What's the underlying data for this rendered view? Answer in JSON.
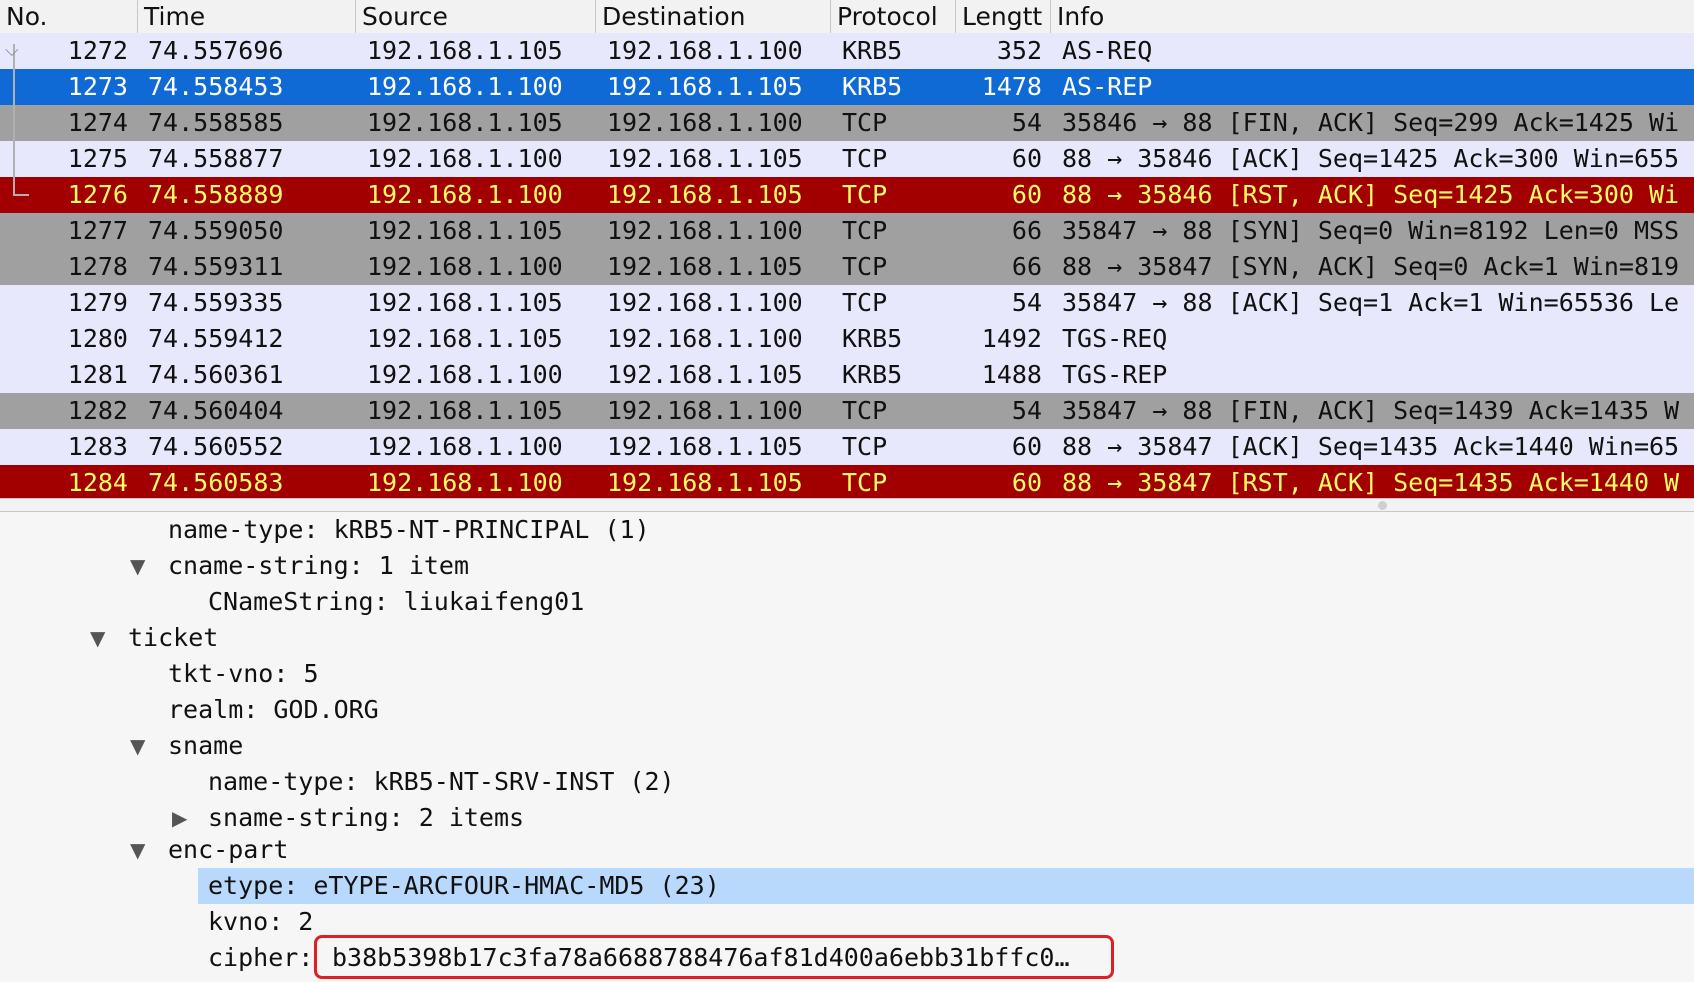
{
  "columns": {
    "no": "No.",
    "time": "Time",
    "source": "Source",
    "destination": "Destination",
    "protocol": "Protocol",
    "length": "Lengtt",
    "info": "Info"
  },
  "packets": [
    {
      "no": "1272",
      "time": "74.557696",
      "src": "192.168.1.105",
      "dst": "192.168.1.100",
      "proto": "KRB5",
      "len": "352",
      "info": "AS-REQ",
      "style": "lav"
    },
    {
      "no": "1273",
      "time": "74.558453",
      "src": "192.168.1.100",
      "dst": "192.168.1.105",
      "proto": "KRB5",
      "len": "1478",
      "info": "AS-REP",
      "style": "sel"
    },
    {
      "no": "1274",
      "time": "74.558585",
      "src": "192.168.1.105",
      "dst": "192.168.1.100",
      "proto": "TCP",
      "len": "54",
      "info": "35846 → 88 [FIN, ACK] Seq=299 Ack=1425 Wi",
      "style": "gray"
    },
    {
      "no": "1275",
      "time": "74.558877",
      "src": "192.168.1.100",
      "dst": "192.168.1.105",
      "proto": "TCP",
      "len": "60",
      "info": "88 → 35846 [ACK] Seq=1425 Ack=300 Win=655",
      "style": "lav"
    },
    {
      "no": "1276",
      "time": "74.558889",
      "src": "192.168.1.100",
      "dst": "192.168.1.105",
      "proto": "TCP",
      "len": "60",
      "info": "88 → 35846 [RST, ACK] Seq=1425 Ack=300 Wi",
      "style": "red"
    },
    {
      "no": "1277",
      "time": "74.559050",
      "src": "192.168.1.105",
      "dst": "192.168.1.100",
      "proto": "TCP",
      "len": "66",
      "info": "35847 → 88 [SYN] Seq=0 Win=8192 Len=0 MSS",
      "style": "gray"
    },
    {
      "no": "1278",
      "time": "74.559311",
      "src": "192.168.1.100",
      "dst": "192.168.1.105",
      "proto": "TCP",
      "len": "66",
      "info": "88 → 35847 [SYN, ACK] Seq=0 Ack=1 Win=819",
      "style": "gray"
    },
    {
      "no": "1279",
      "time": "74.559335",
      "src": "192.168.1.105",
      "dst": "192.168.1.100",
      "proto": "TCP",
      "len": "54",
      "info": "35847 → 88 [ACK] Seq=1 Ack=1 Win=65536 Le",
      "style": "lav"
    },
    {
      "no": "1280",
      "time": "74.559412",
      "src": "192.168.1.105",
      "dst": "192.168.1.100",
      "proto": "KRB5",
      "len": "1492",
      "info": "TGS-REQ",
      "style": "lav"
    },
    {
      "no": "1281",
      "time": "74.560361",
      "src": "192.168.1.100",
      "dst": "192.168.1.105",
      "proto": "KRB5",
      "len": "1488",
      "info": "TGS-REP",
      "style": "lav"
    },
    {
      "no": "1282",
      "time": "74.560404",
      "src": "192.168.1.105",
      "dst": "192.168.1.100",
      "proto": "TCP",
      "len": "54",
      "info": "35847 → 88 [FIN, ACK] Seq=1439 Ack=1435 W",
      "style": "gray"
    },
    {
      "no": "1283",
      "time": "74.560552",
      "src": "192.168.1.100",
      "dst": "192.168.1.105",
      "proto": "TCP",
      "len": "60",
      "info": "88 → 35847 [ACK] Seq=1435 Ack=1440 Win=65",
      "style": "lav"
    },
    {
      "no": "1284",
      "time": "74.560583",
      "src": "192.168.1.100",
      "dst": "192.168.1.105",
      "proto": "TCP",
      "len": "60",
      "info": "88 → 35847 [RST, ACK] Seq=1435 Ack=1440 W",
      "style": "red"
    }
  ],
  "detail": {
    "name_type": "name-type: kRB5-NT-PRINCIPAL (1)",
    "cname_string": "cname-string: 1 item",
    "cname_value": "CNameString: liukaifeng01",
    "ticket": "ticket",
    "tkt_vno": "tkt-vno: 5",
    "realm": "realm: GOD.ORG",
    "sname": "sname",
    "sname_name_type": "name-type: kRB5-NT-SRV-INST (2)",
    "sname_string": "sname-string: 2 items",
    "enc_part": "enc-part",
    "etype": "etype: eTYPE-ARCFOUR-HMAC-MD5 (23)",
    "kvno": "kvno: 2",
    "cipher_label": "cipher:",
    "cipher_value": "b38b5398b17c3fa78a6688788476af81d400a6ebb31bffc0…"
  },
  "icons": {
    "expanded": "▼",
    "collapsed": "▶"
  },
  "colors": {
    "selected_row": "#106ad6",
    "rst_row_bg": "#a20000",
    "rst_row_fg": "#fffb68",
    "gray_row": "#a0a0a0",
    "lavender_row": "#e8e8fd",
    "field_highlight": "#b8d8fc",
    "annotation_box": "#e02020"
  }
}
